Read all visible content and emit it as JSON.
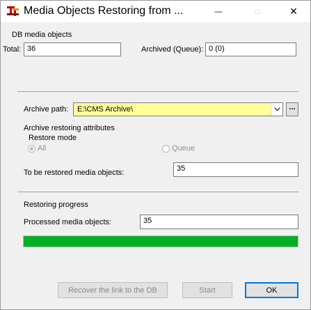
{
  "window": {
    "title": "Media Objects Restoring from ...",
    "controls": {
      "minimize": "—",
      "maximize": "□",
      "close": "✕"
    },
    "icon": "media-restore-app-icon"
  },
  "db_section": {
    "heading": "DB media objects",
    "total_label": "Total:",
    "total_value": "36",
    "archived_label": "Archived (Queue):",
    "archived_value": "0 (0)"
  },
  "archive": {
    "path_label": "Archive path:",
    "path_value": "E:\\CMS Archive\\",
    "dropdown_icon": "chevron-down-icon",
    "browse_label": "..."
  },
  "attributes": {
    "heading": "Archive restoring attributes",
    "restore_mode_heading": "Restore mode",
    "options": [
      {
        "label": "All",
        "selected": true
      },
      {
        "label": "Queue",
        "selected": false
      }
    ],
    "to_restore_label": "To be restored media objects:",
    "to_restore_value": "35"
  },
  "progress": {
    "heading": "Restoring progress",
    "processed_label": "Processed media objects:",
    "processed_value": "35",
    "fraction": 1.0,
    "color": "#06b025"
  },
  "buttons": {
    "recover": "Recover the link to the DB",
    "start": "Start",
    "ok": "OK"
  }
}
